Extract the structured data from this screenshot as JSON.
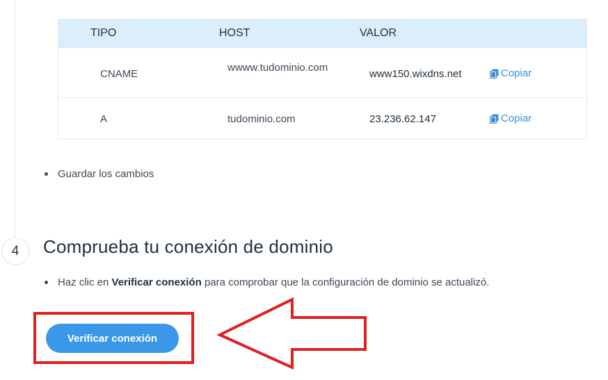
{
  "dns_table": {
    "headers": {
      "type": "TIPO",
      "host": "HOST",
      "value": "VALOR"
    },
    "rows": [
      {
        "type": "CNAME",
        "host": "wwww.tudominio.com",
        "value": "www150.wixdns.net",
        "copy_label": "Copiar"
      },
      {
        "type": "A",
        "host": "tudominio.com",
        "value": "23.236.62.147",
        "copy_label": "Copiar"
      }
    ]
  },
  "step3": {
    "bullet": "Guardar los cambios"
  },
  "step4": {
    "number": "4",
    "title": "Comprueba tu conexión de dominio",
    "bullet_prefix": "Haz clic en ",
    "bullet_bold": "Verificar conexión",
    "bullet_suffix": " para comprobar que la configuración de dominio se actualizó.",
    "button_label": "Verificar conexión"
  },
  "colors": {
    "accent": "#3b98e8",
    "link": "#3a8fdb",
    "header_bg": "#daeefc",
    "annotation": "#e02020"
  },
  "icons": {
    "copy": "copy-icon",
    "arrow": "arrow-left-annotation"
  }
}
